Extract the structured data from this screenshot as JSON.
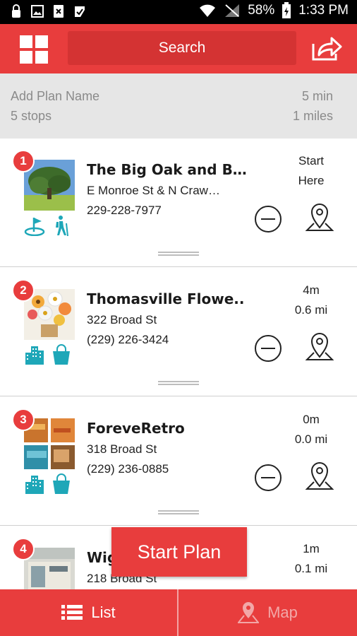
{
  "status_bar": {
    "battery": "58%",
    "time": "1:33 PM",
    "icons": [
      "lock-icon",
      "image-icon",
      "doc-x-icon",
      "checklist-icon",
      "wifi-icon",
      "signal-icon",
      "battery-icon"
    ]
  },
  "header": {
    "search_label": "Search",
    "menu_icon": "grid-icon",
    "share_icon": "share-icon"
  },
  "plan": {
    "name_placeholder": "Add Plan Name",
    "stops": "5 stops",
    "duration": "5 min",
    "distance": "1 miles"
  },
  "stops": [
    {
      "number": "1",
      "title": "The Big Oak and B…",
      "address": "E Monroe St & N Craw…",
      "phone": "229-228-7977",
      "meta_line1": "Start",
      "meta_line2": "Here",
      "category_icons": [
        "golf-icon",
        "hiking-icon"
      ]
    },
    {
      "number": "2",
      "title": "Thomasville Flowe..",
      "address": "322 Broad St",
      "phone": "(229) 226-3424",
      "meta_line1": "4m",
      "meta_line2": "0.6 mi",
      "category_icons": [
        "city-icon",
        "shopping-bag-icon"
      ]
    },
    {
      "number": "3",
      "title": "ForeveRetro",
      "address": "318 Broad St",
      "phone": "(229) 236-0885",
      "meta_line1": "0m",
      "meta_line2": "0.0 mi",
      "category_icons": [
        "city-icon",
        "shopping-bag-icon"
      ]
    },
    {
      "number": "4",
      "title": "Wig",
      "address": "218 Broad St",
      "phone": "",
      "meta_line1": "1m",
      "meta_line2": "0.1 mi",
      "category_icons": [
        "city-icon",
        "shopping-bag-icon"
      ]
    }
  ],
  "start_plan_label": "Start Plan",
  "tabs": {
    "list_label": "List",
    "map_label": "Map"
  },
  "colors": {
    "accent": "#e83d3d",
    "accent_dark": "#d43333",
    "teal": "#1ea7b8",
    "plan_bg": "#e6e6e6"
  }
}
